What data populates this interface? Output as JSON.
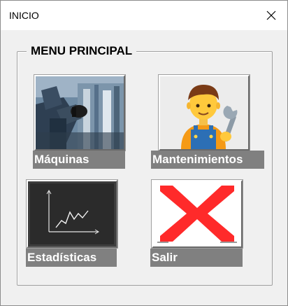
{
  "window": {
    "title": "INICIO"
  },
  "group": {
    "title": "MENU PRINCIPAL"
  },
  "tiles": [
    {
      "label": "Máquinas",
      "image": "factory-worker-image"
    },
    {
      "label": "Mantenimientos",
      "image": "mechanic-emoji-image"
    },
    {
      "label": "Estadísticas",
      "image": "chalkboard-chart-image"
    },
    {
      "label": "Salir",
      "image": "red-x-image"
    }
  ],
  "colors": {
    "label_bg": "#808080",
    "exit_x": "#ff2a2a",
    "chalkboard": "#2b2b2b"
  }
}
